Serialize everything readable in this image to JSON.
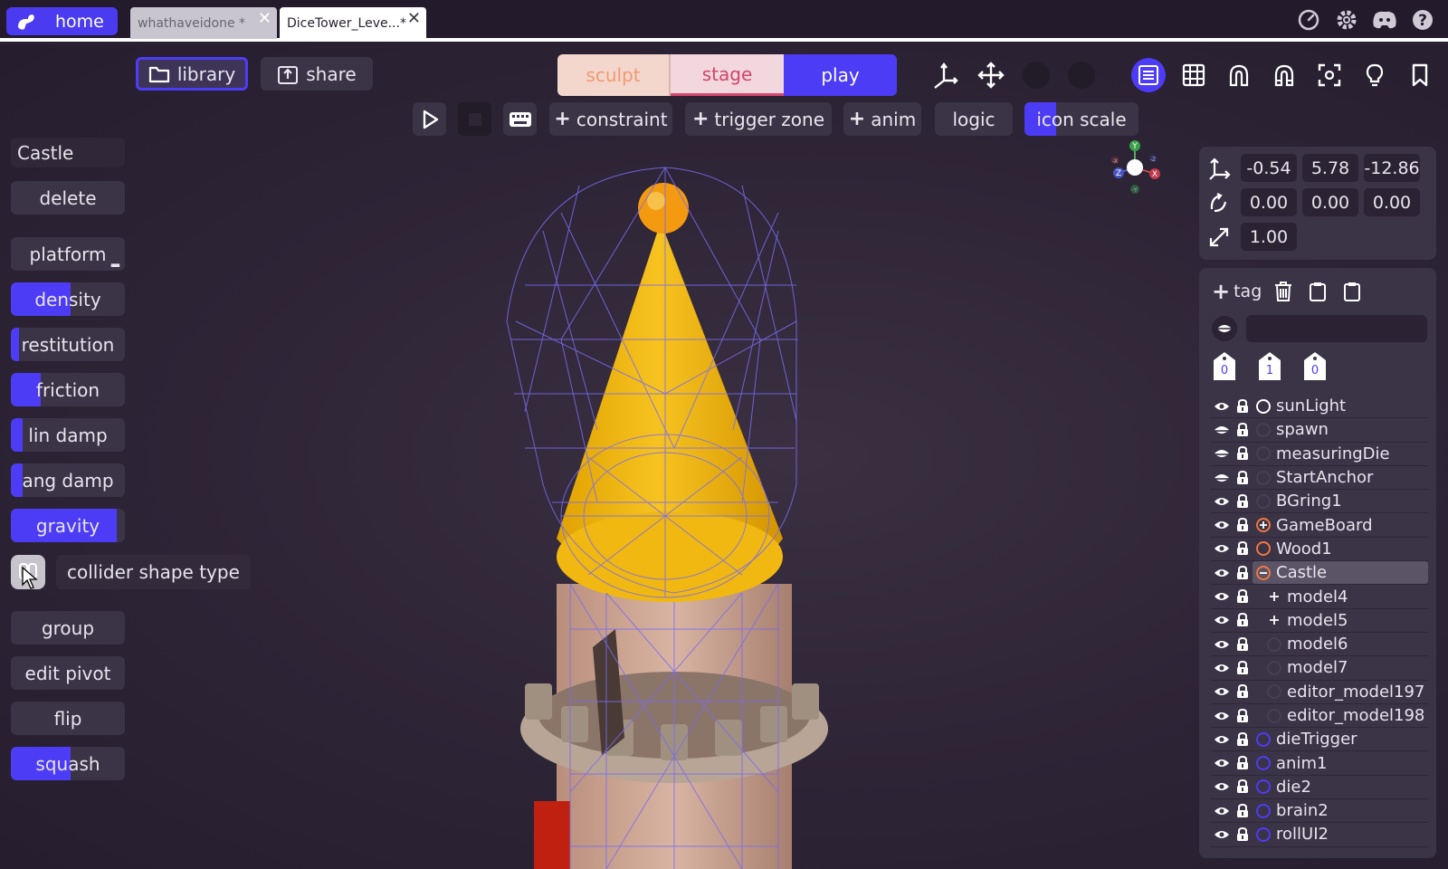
{
  "topbar": {
    "home_label": "home",
    "tabs": [
      {
        "label": "whathaveidone *",
        "active": false
      },
      {
        "label": "DiceTower_Leve...*",
        "active": true
      }
    ],
    "icons": [
      "speedometer-icon",
      "gear-icon",
      "discord-icon",
      "help-icon"
    ]
  },
  "toolbar": {
    "library_label": "library",
    "share_label": "share",
    "modes": [
      {
        "label": "sculpt"
      },
      {
        "label": "stage"
      },
      {
        "label": "play"
      }
    ],
    "row2": {
      "constraint_label": "constraint",
      "trigger_zone_label": "trigger zone",
      "anim_label": "anim",
      "logic_label": "logic",
      "icon_scale_label": "icon scale",
      "icon_scale_level": 0.28
    }
  },
  "left_panel": {
    "object_name": "Castle",
    "delete_label": "delete",
    "platform_label": "platform",
    "sliders": [
      {
        "label": "density",
        "level": 0.52
      },
      {
        "label": "restitution",
        "level": 0.07
      },
      {
        "label": "friction",
        "level": 0.26
      },
      {
        "label": "lin damp",
        "level": 0.1
      },
      {
        "label": "ang damp",
        "level": 0.1
      },
      {
        "label": "gravity",
        "level": 0.93
      }
    ],
    "collider_label": "collider shape type",
    "group_label": "group",
    "edit_pivot_label": "edit pivot",
    "flip_label": "flip",
    "squash_label": "squash",
    "squash_level": 0.52
  },
  "transform": {
    "position": [
      "-0.54",
      "5.78",
      "-12.86"
    ],
    "rotation": [
      "0.00",
      "0.00",
      "0.00"
    ],
    "scale": "1.00"
  },
  "gizmo": {
    "y": "Y",
    "x": "X",
    "z": "Z",
    "ny": "-Y",
    "nx": "-X",
    "nz": "-Z"
  },
  "outliner": {
    "tag_label": "tag",
    "tag_counts": [
      "0",
      "1",
      "0"
    ],
    "items": [
      {
        "name": "sunLight",
        "marker": "ring-white",
        "child": false
      },
      {
        "name": "spawn",
        "marker": "none",
        "child": false
      },
      {
        "name": "measuringDie",
        "marker": "none",
        "child": false
      },
      {
        "name": "StartAnchor",
        "marker": "none",
        "child": false
      },
      {
        "name": "BGring1",
        "marker": "none",
        "child": false
      },
      {
        "name": "GameBoard",
        "marker": "plus-orange",
        "child": false
      },
      {
        "name": "Wood1",
        "marker": "ring-orange",
        "child": false
      },
      {
        "name": "Castle",
        "marker": "minus-orange",
        "child": false,
        "selected": true
      },
      {
        "name": "model4",
        "marker": "plus",
        "child": true
      },
      {
        "name": "model5",
        "marker": "plus",
        "child": true
      },
      {
        "name": "model6",
        "marker": "none",
        "child": true
      },
      {
        "name": "model7",
        "marker": "none",
        "child": true
      },
      {
        "name": "editor_model197",
        "marker": "none",
        "child": true
      },
      {
        "name": "editor_model198",
        "marker": "none",
        "child": true
      },
      {
        "name": "dieTrigger",
        "marker": "ring-blue",
        "child": false
      },
      {
        "name": "anim1",
        "marker": "ring-blue",
        "child": false
      },
      {
        "name": "die2",
        "marker": "ring-blue",
        "child": false
      },
      {
        "name": "brain2",
        "marker": "ring-blue",
        "child": false
      },
      {
        "name": "rollUI2",
        "marker": "ring-blue",
        "child": false
      }
    ]
  },
  "colors": {
    "accent": "#4d3cf5",
    "orange": "#f0763e",
    "panel": "#3b3346",
    "background": "#2a2033"
  }
}
